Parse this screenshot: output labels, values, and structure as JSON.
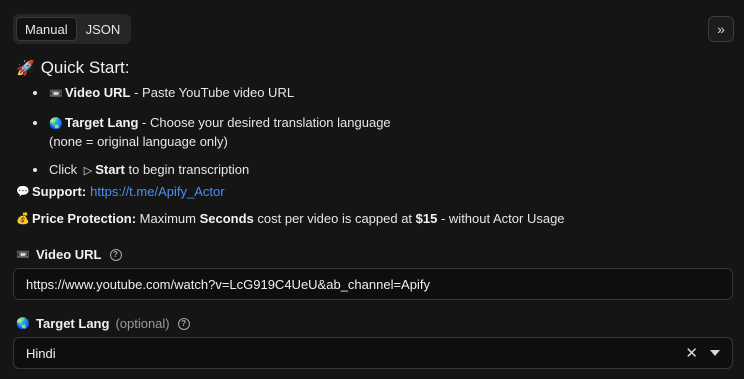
{
  "tabs": [
    {
      "label": "Manual",
      "active": true
    },
    {
      "label": "JSON",
      "active": false
    }
  ],
  "collapse_button": {
    "glyph": "»"
  },
  "quick_start": {
    "icon": "🚀",
    "title": "Quick Start:",
    "items": [
      {
        "icon": "📼",
        "bold": "Video URL",
        "text": " - Paste YouTube video URL"
      },
      {
        "icon": "🌏",
        "bold": "Target Lang",
        "text": " - Choose your desired translation language",
        "note": "(none = original language only)"
      },
      {
        "prefix": "Click ",
        "play_glyph": "▷",
        "bold": "Start",
        "text": " to begin transcription"
      }
    ]
  },
  "support": {
    "icon": "💬",
    "label": "Support:",
    "link": "https://t.me/Apify_Actor"
  },
  "price": {
    "icon": "💰",
    "label": "Price Protection:",
    "text1": " Maximum ",
    "bold1": "Seconds",
    "text2": " cost per video is capped at ",
    "bold2": "$15",
    "text3": " - without Actor Usage"
  },
  "video_url_field": {
    "icon": "📼",
    "label": "Video URL",
    "help": "?",
    "value": "https://www.youtube.com/watch?v=LcG919C4UeU&ab_channel=Apify"
  },
  "target_lang_field": {
    "icon": "🌏",
    "label": "Target Lang",
    "optional": "(optional)",
    "help": "?",
    "value": "Hindi",
    "clear_glyph": "✕"
  }
}
